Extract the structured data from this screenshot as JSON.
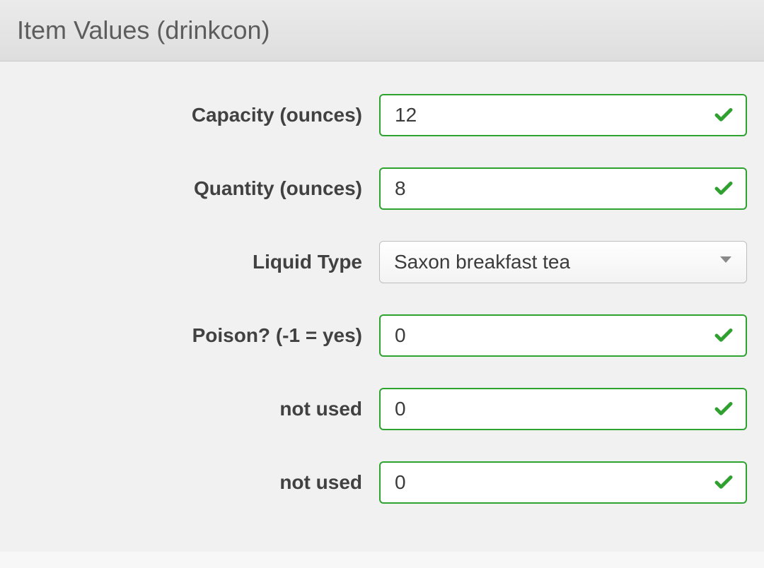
{
  "header": {
    "title": "Item Values (drinkcon)"
  },
  "fields": {
    "capacity": {
      "label": "Capacity (ounces)",
      "value": "12"
    },
    "quantity": {
      "label": "Quantity (ounces)",
      "value": "8"
    },
    "liquid": {
      "label": "Liquid Type",
      "value": "Saxon breakfast tea"
    },
    "poison": {
      "label": "Poison? (-1 = yes)",
      "value": "0"
    },
    "unused1": {
      "label": "not used",
      "value": "0"
    },
    "unused2": {
      "label": "not used",
      "value": "0"
    }
  },
  "colors": {
    "valid_border": "#2fa32f",
    "check": "#30a030"
  }
}
